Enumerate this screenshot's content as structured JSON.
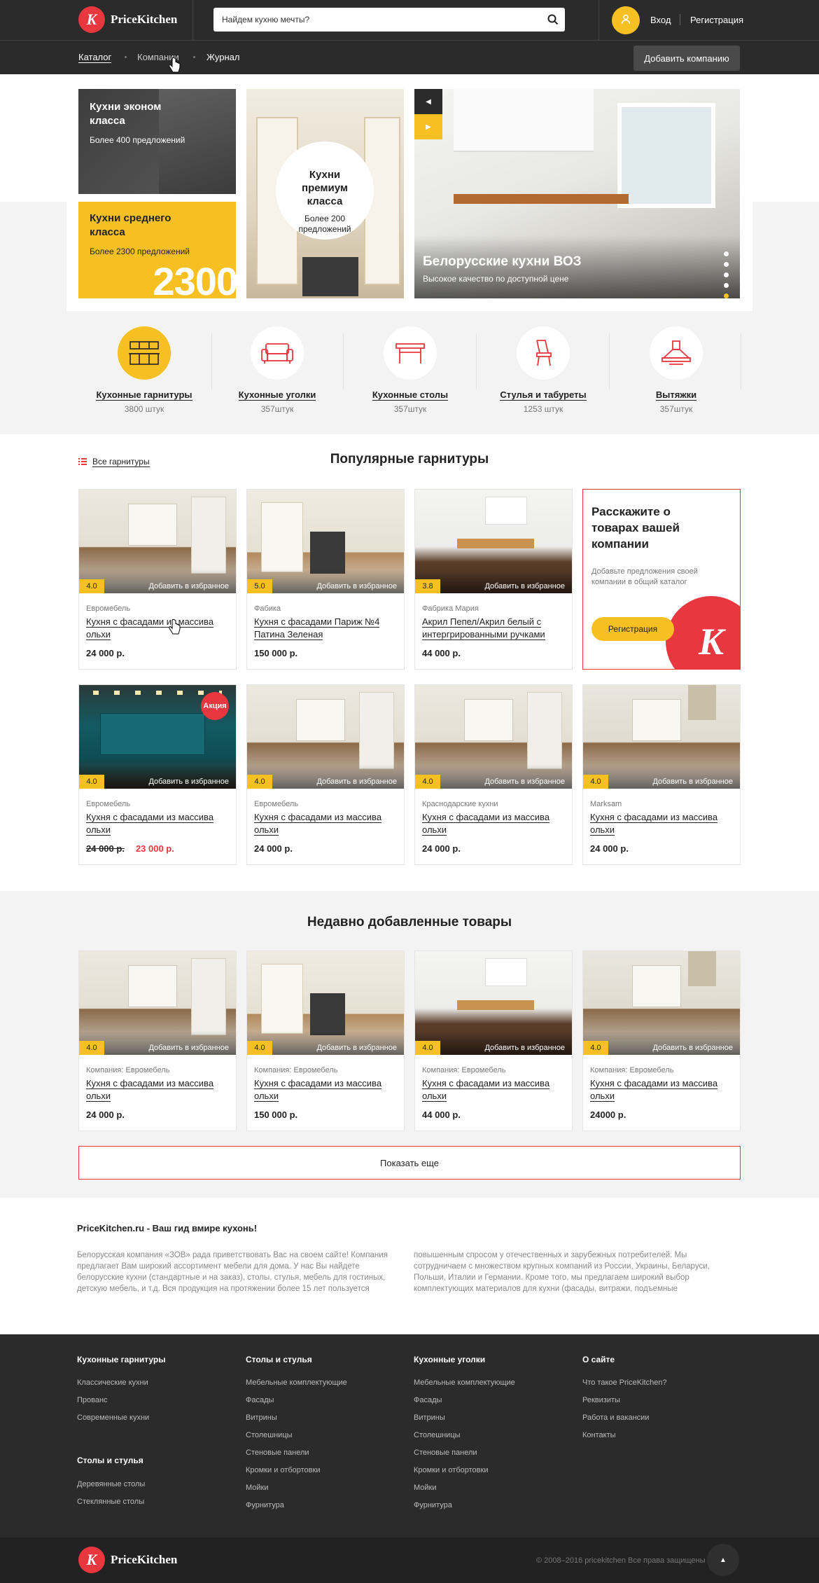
{
  "header": {
    "logo_text": "PriceKitchen",
    "logo_mark": "K",
    "search_placeholder": "Найдем кухню мечты?",
    "login": "Вход",
    "register": "Регистрация"
  },
  "nav": {
    "items": [
      "Каталог",
      "Компании",
      "Журнал"
    ],
    "add_company": "Добавить компанию"
  },
  "hero": {
    "economy": {
      "title": "Кухни эконом класса",
      "subtitle": "Более 400 предложений"
    },
    "middle": {
      "title": "Кухни среднего класса",
      "subtitle": "Более 2300 предложений",
      "big_number": "2300"
    },
    "premium": {
      "title": "Кухни премиум класса",
      "subtitle": "Более 200 предложений"
    },
    "banner": {
      "title": "Белорусские кухни ВОЗ",
      "subtitle": "Высокое качество по доступной цене"
    }
  },
  "categories": [
    {
      "name": "Кухонные гарнитуры",
      "count": "3800 штук",
      "icon": "kitchen-set-icon"
    },
    {
      "name": "Кухонные уголки",
      "count": "357штук",
      "icon": "sofa-icon"
    },
    {
      "name": "Кухонные столы",
      "count": "357штук",
      "icon": "table-icon"
    },
    {
      "name": "Стулья и табуреты",
      "count": "1253 штук",
      "icon": "chair-icon"
    },
    {
      "name": "Вытяжки",
      "count": "357штук",
      "icon": "hood-icon"
    }
  ],
  "popular": {
    "title": "Популярные гарнитуры",
    "all_link": "Все гарнитуры",
    "fav_label": "Добавить в избранное",
    "cards": [
      {
        "rating": "4.0",
        "maker": "Евромебель",
        "title": "Кухня с фасадами из массива ольхи",
        "price": "24 000 р."
      },
      {
        "rating": "5.0",
        "maker": "Фабика",
        "title": "Кухня с фасадами Париж №4 Патина Зеленая",
        "price": "150 000 р."
      },
      {
        "rating": "3.8",
        "maker": "Фабрика Мария",
        "title": "Акрил Пепел/Акрил белый с интергрированными ручками",
        "price": "44 000 р."
      },
      {
        "rating": "4.0",
        "maker": "Евромебель",
        "title": "Кухня с фасадами из массива ольхи",
        "old_price": "24 000 р.",
        "price": "23 000 р.",
        "badge": "Акция"
      },
      {
        "rating": "4.0",
        "maker": "Евромебель",
        "title": "Кухня с фасадами из массива ольхи",
        "price": "24 000 р."
      },
      {
        "rating": "4.0",
        "maker": "Краснодарские кухни",
        "title": "Кухня с фасадами из массива ольхи",
        "price": "24 000 р."
      },
      {
        "rating": "4.0",
        "maker": "Marksam",
        "title": "Кухня с фасадами из массива ольхи",
        "price": "24 000 р."
      }
    ],
    "promo": {
      "title": "Расскажите о товарах вашей компании",
      "text": "Добавьте предложения своей компании в общий каталог",
      "button": "Регистрация"
    }
  },
  "recent": {
    "title": "Недавно добавленные товары",
    "cards": [
      {
        "rating": "4.0",
        "maker": "Компания: Евромебель",
        "title": "Кухня с фасадами из массива ольхи",
        "price": "24 000 р."
      },
      {
        "rating": "4.0",
        "maker": "Компания: Евромебель",
        "title": "Кухня с фасадами из массива ольхи",
        "price": "150 000 р."
      },
      {
        "rating": "4.0",
        "maker": "Компания: Евромебель",
        "title": "Кухня с фасадами из массива ольхи",
        "price": "44 000 р."
      },
      {
        "rating": "4.0",
        "maker": "Компания: Евромебель",
        "title": "Кухня с фасадами из массива ольхи",
        "price": "24000 р."
      }
    ],
    "show_more": "Показать еще"
  },
  "about": {
    "title": "PriceKitchen.ru - Ваш гид вмире кухонь!",
    "col1": "Белорусская компания «ЗОВ» рада приветствовать Вас на своем сайте! Компания предлагает Вам широкий ассортимент мебели для дома. У нас Вы найдете белорусские кухни (стандартные и на заказ), столы, стулья, мебель для гостиных, детскую мебель, и т.д. Вся продукция на протяжении более 15 лет пользуется",
    "col2": "повышенным спросом у отечественных и зарубежных потребителей. Мы сотрудничаем с множеством крупных компаний из России, Украины, Беларуси, Польши, Италии и Германии. Кроме того, мы предлагаем широкий выбор комплектующих материалов для кухни (фасады, витражи, подъемные"
  },
  "footer": {
    "col1": {
      "title": "Кухонные гарнитуры",
      "links": [
        "Классические кухни",
        "Прованс",
        "Современные кухни"
      ]
    },
    "col1b": {
      "title": "Столы и стулья",
      "links": [
        "Деревянные столы",
        "Стеклянные столы"
      ]
    },
    "col2": {
      "title": "Столы и стулья",
      "links": [
        "Мебельные комплектующие",
        "Фасады",
        "Витрины",
        "Столешницы",
        "Стеновые панели",
        "Кромки и отбортовки",
        "Мойки",
        "Фурнитура"
      ]
    },
    "col3": {
      "title": "Кухонные уголки",
      "links": [
        "Мебельные комплектующие",
        "Фасады",
        "Витрины",
        "Столешницы",
        "Стеновые панели",
        "Кромки и отбортовки",
        "Мойки",
        "Фурнитура"
      ]
    },
    "col4": {
      "title": "О сайте",
      "links": [
        "Что такое PriceKitchen?",
        "Реквизиты",
        "Работа и вакансии",
        "Контакты"
      ]
    },
    "copyright": "© 2008–2016 pricekitchen Все права защищены"
  },
  "colors": {
    "accent_red": "#e8373e",
    "accent_yellow": "#f6c023",
    "dark": "#2b2b2b"
  }
}
